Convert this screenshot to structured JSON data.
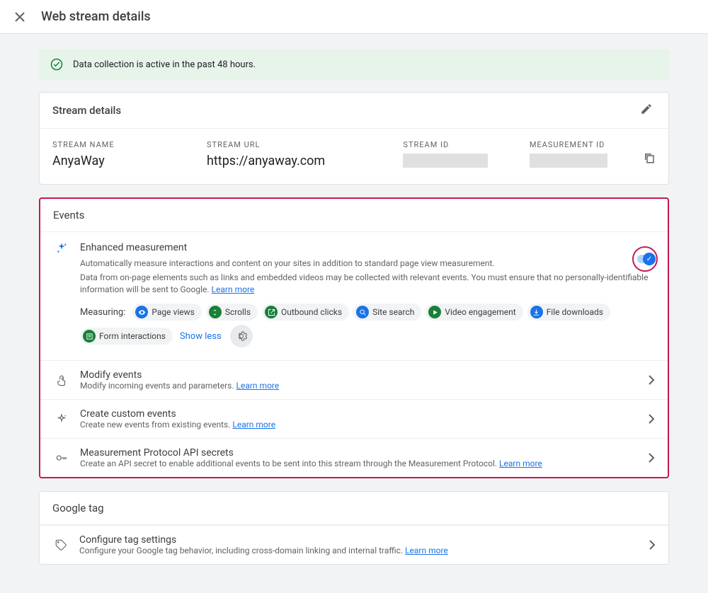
{
  "header": {
    "title": "Web stream details"
  },
  "notice": {
    "text": "Data collection is active in the past 48 hours."
  },
  "stream_details": {
    "title": "Stream details",
    "name_label": "STREAM NAME",
    "name_value": "AnyaWay",
    "url_label": "STREAM URL",
    "url_value": "https://anyaway.com",
    "id_label": "STREAM ID",
    "mid_label": "MEASUREMENT ID"
  },
  "events": {
    "title": "Events",
    "enhanced": {
      "title": "Enhanced measurement",
      "desc1": "Automatically measure interactions and content on your sites in addition to standard page view measurement.",
      "desc2": "Data from on-page elements such as links and embedded videos may be collected with relevant events. You must ensure that no personally-identifiable information will be sent to Google.",
      "learn": "Learn more",
      "measuring_label": "Measuring:",
      "chips": [
        {
          "label": "Page views",
          "color": "ci-blue",
          "glyph": "eye"
        },
        {
          "label": "Scrolls",
          "color": "ci-teal",
          "glyph": "scroll"
        },
        {
          "label": "Outbound clicks",
          "color": "ci-teal",
          "glyph": "out"
        },
        {
          "label": "Site search",
          "color": "ci-blue",
          "glyph": "search"
        },
        {
          "label": "Video engagement",
          "color": "ci-teal",
          "glyph": "play"
        },
        {
          "label": "File downloads",
          "color": "ci-blue",
          "glyph": "download"
        },
        {
          "label": "Form interactions",
          "color": "ci-teal",
          "glyph": "form"
        }
      ],
      "show_less": "Show less"
    },
    "items": [
      {
        "title": "Modify events",
        "sub": "Modify incoming events and parameters.",
        "learn": "Learn more",
        "icon": "touch"
      },
      {
        "title": "Create custom events",
        "sub": "Create new events from existing events.",
        "learn": "Learn more",
        "icon": "sparkle"
      },
      {
        "title": "Measurement Protocol API secrets",
        "sub": "Create an API secret to enable additional events to be sent into this stream through the Measurement Protocol.",
        "learn": "Learn more",
        "icon": "key"
      }
    ]
  },
  "gtag": {
    "title": "Google tag",
    "item": {
      "title": "Configure tag settings",
      "sub": "Configure your Google tag behavior, including cross-domain linking and internal traffic.",
      "learn": "Learn more",
      "icon": "tag"
    }
  }
}
